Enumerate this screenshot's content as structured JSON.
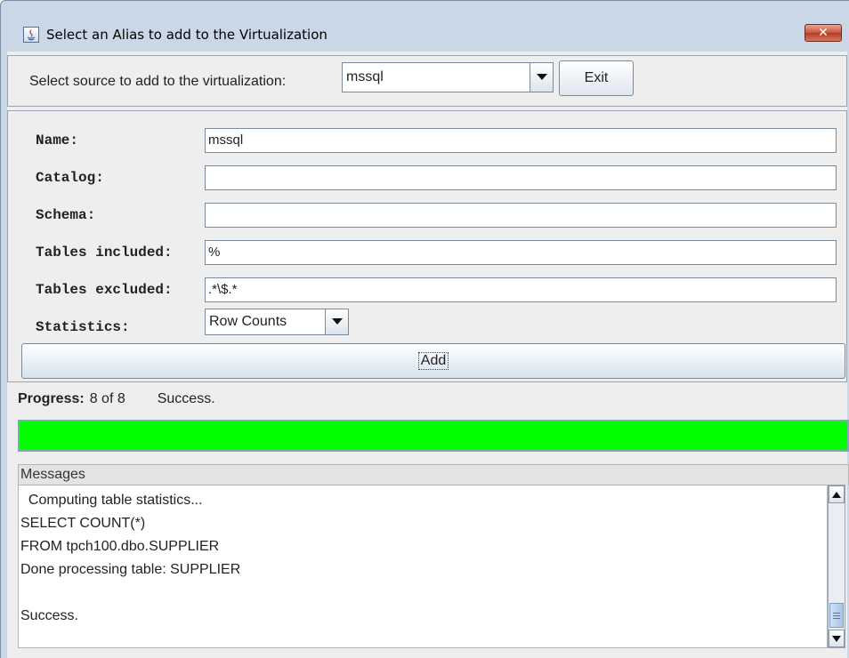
{
  "window": {
    "title": "Select an Alias to add to the Virtualization",
    "close_icon": "close-icon"
  },
  "source": {
    "label": "Select source to add to the virtualization:",
    "selected": "mssql",
    "exit_label": "Exit"
  },
  "form": {
    "name_label": "Name:",
    "name_value": "mssql",
    "catalog_label": "Catalog:",
    "catalog_value": "",
    "schema_label": "Schema:",
    "schema_value": "",
    "tables_included_label": "Tables included:",
    "tables_included_value": "%",
    "tables_excluded_label": "Tables excluded:",
    "tables_excluded_value": ".*\\$.*",
    "statistics_label": "Statistics:",
    "statistics_selected": "Row Counts",
    "add_label": "Add"
  },
  "progress": {
    "label": "Progress:",
    "count": "8 of 8",
    "status": "Success.",
    "fraction": 1.0,
    "fill_color": "#00ff00"
  },
  "messages": {
    "header": "Messages",
    "lines": [
      "  Computing table statistics...",
      "SELECT COUNT(*)",
      "FROM tpch100.dbo.SUPPLIER",
      "Done processing table: SUPPLIER",
      "",
      "Success."
    ]
  }
}
